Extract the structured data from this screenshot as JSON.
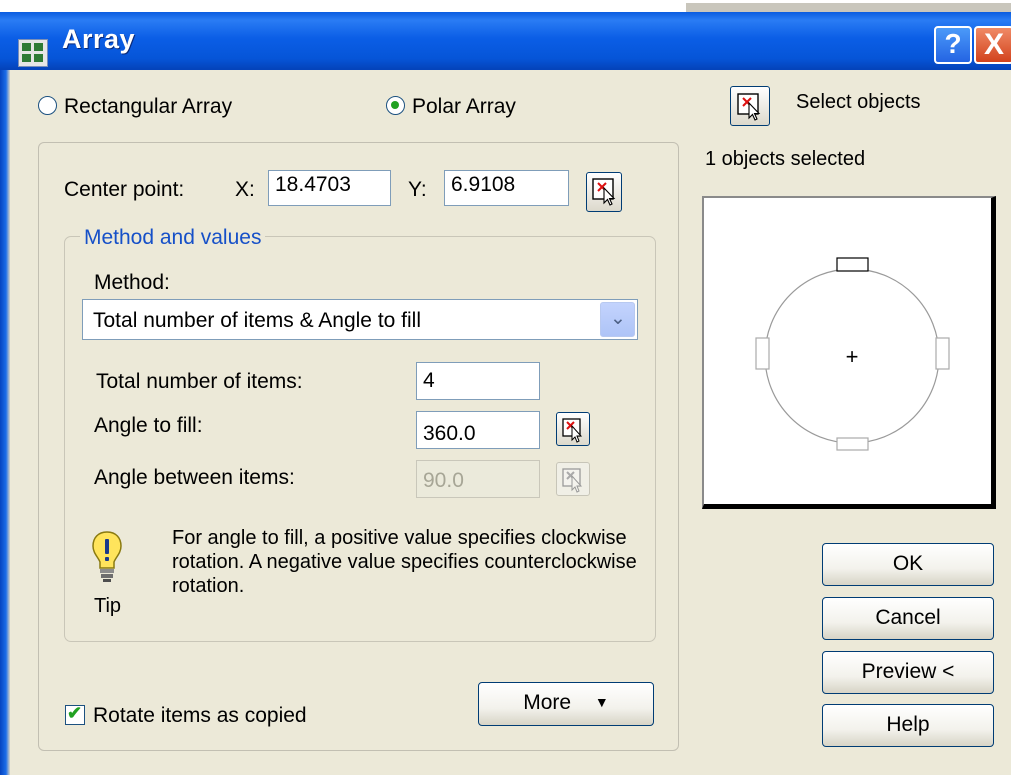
{
  "window": {
    "title": "Array",
    "help_button": "?",
    "close_button": "X"
  },
  "array_type": {
    "rectangular_label": "Rectangular Array",
    "polar_label": "Polar Array",
    "selected": "Polar Array"
  },
  "center_point": {
    "label": "Center point:",
    "x_label": "X:",
    "x_value": "18.4703",
    "y_label": "Y:",
    "y_value": "6.9108"
  },
  "method_group": {
    "title": "Method and values",
    "method_label": "Method:",
    "method_value": "Total number of items & Angle to fill",
    "total_items_label": "Total number of items:",
    "total_items_value": "4",
    "angle_fill_label": "Angle to fill:",
    "angle_fill_value": "360.0",
    "angle_between_label": "Angle between items:",
    "angle_between_value": "90.0"
  },
  "tip": {
    "label": "Tip",
    "text": "For angle to fill, a positive value specifies clockwise rotation.  A negative value specifies counterclockwise rotation."
  },
  "rotate_items": {
    "label": "Rotate items as copied",
    "checked": true
  },
  "more_button": {
    "label": "More",
    "glyph": "▼"
  },
  "selection": {
    "select_objects_label": "Select objects",
    "status": "1 objects selected"
  },
  "preview": {
    "center_marker": "+",
    "item_count": 4
  },
  "buttons": {
    "ok": "OK",
    "cancel": "Cancel",
    "preview": "Preview <",
    "help": "Help"
  },
  "colors": {
    "titlebar": "#0a5ce0",
    "dialog_bg": "#ece9d8",
    "group_title": "#1650c8",
    "radio_check": "#21a121"
  }
}
